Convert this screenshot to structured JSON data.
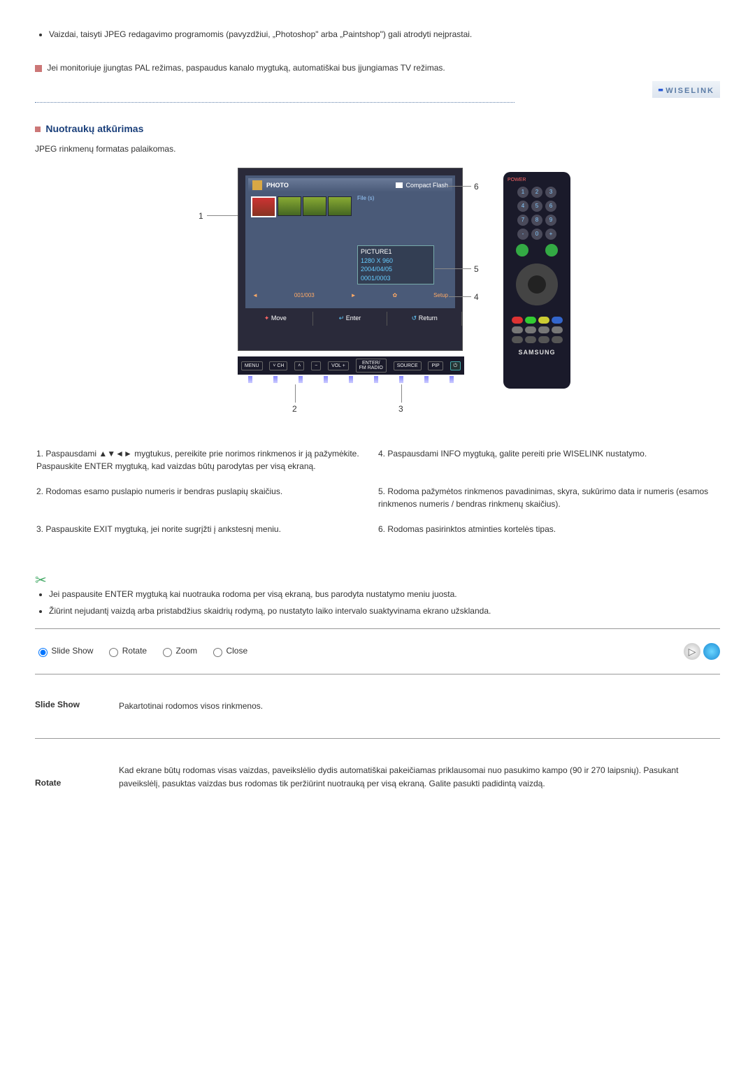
{
  "top_bullets": [
    "Vaizdai, taisyti JPEG redagavimo programomis (pavyzdžiui, „Photoshop\" arba „Paintshop\") gali atrodyti neįprastai."
  ],
  "top_note": "Jei monitoriuje įjungtas PAL režimas, paspaudus kanalo mygtuką, automatiškai bus įjungiamas TV režimas.",
  "logo_text": "WISELINK",
  "section": {
    "title": "Nuotraukų atkūrimas",
    "subtitle": "JPEG rinkmenų formatas palaikomas."
  },
  "diagram": {
    "top_bar": {
      "photo": "PHOTO",
      "card": "Compact Flash"
    },
    "panel_label": "File (s)",
    "info": {
      "name": "PICTURE1",
      "res": "1280 X 960",
      "date": "2004/04/05",
      "count": "0001/0003"
    },
    "setup_bar": {
      "left": "001/003",
      "right": "Setup"
    },
    "hints": {
      "move": "Move",
      "enter": "Enter",
      "return": "Return"
    },
    "buttons": {
      "menu": "MENU",
      "ch": "CH",
      "vol": "VOL",
      "enter": "ENTER/\nFM RADIO",
      "source": "SOURCE",
      "pip": "PIP"
    },
    "callouts": {
      "c1": "1",
      "c2": "2",
      "c3": "3",
      "c4": "4",
      "c5": "5",
      "c6": "6"
    },
    "remote": {
      "power": "POWER",
      "brand": "SAMSUNG"
    }
  },
  "instructions": {
    "i1": "1. Paspausdami ▲▼◄► mygtukus, pereikite prie norimos rinkmenos ir ją pažymėkite. Paspauskite ENTER mygtuką, kad vaizdas būtų parodytas per visą ekraną.",
    "i4": "4. Paspausdami INFO mygtuką, galite pereiti prie WISELINK nustatymo.",
    "i2": "2. Rodomas esamo puslapio numeris ir bendras puslapių skaičius.",
    "i5": "5. Rodoma pažymėtos rinkmenos pavadinimas, skyra, sukūrimo data ir numeris (esamos rinkmenos numeris / bendras rinkmenų skaičius).",
    "i3": "3. Paspauskite EXIT mygtuką, jei norite sugrįžti į ankstesnį meniu.",
    "i6": "6. Rodomas pasirinktos atminties kortelės tipas."
  },
  "bottom_bullets": [
    "Jei paspausite ENTER mygtuką kai nuotrauka rodoma per visą ekraną, bus parodyta nustatymo meniu juosta.",
    "Žiūrint nejudantį vaizdą arba pristabdžius skaidrių rodymą, po nustatyto laiko intervalo suaktyvinama ekrano užsklanda."
  ],
  "radios": {
    "slide": "Slide Show",
    "rotate": "Rotate",
    "zoom": "Zoom",
    "close": "Close"
  },
  "defs": {
    "slide_term": "Slide Show",
    "slide_desc": "Pakartotinai rodomos visos rinkmenos.",
    "rotate_term": "Rotate",
    "rotate_desc": "Kad ekrane būtų rodomas visas vaizdas, paveikslėlio dydis automatiškai pakeičiamas priklausomai nuo pasukimo kampo (90 ir 270 laipsnių). Pasukant paveikslėlį, pasuktas vaizdas bus rodomas tik peržiūrint nuotrauką per visą ekraną. Galite pasukti padidintą vaizdą."
  }
}
